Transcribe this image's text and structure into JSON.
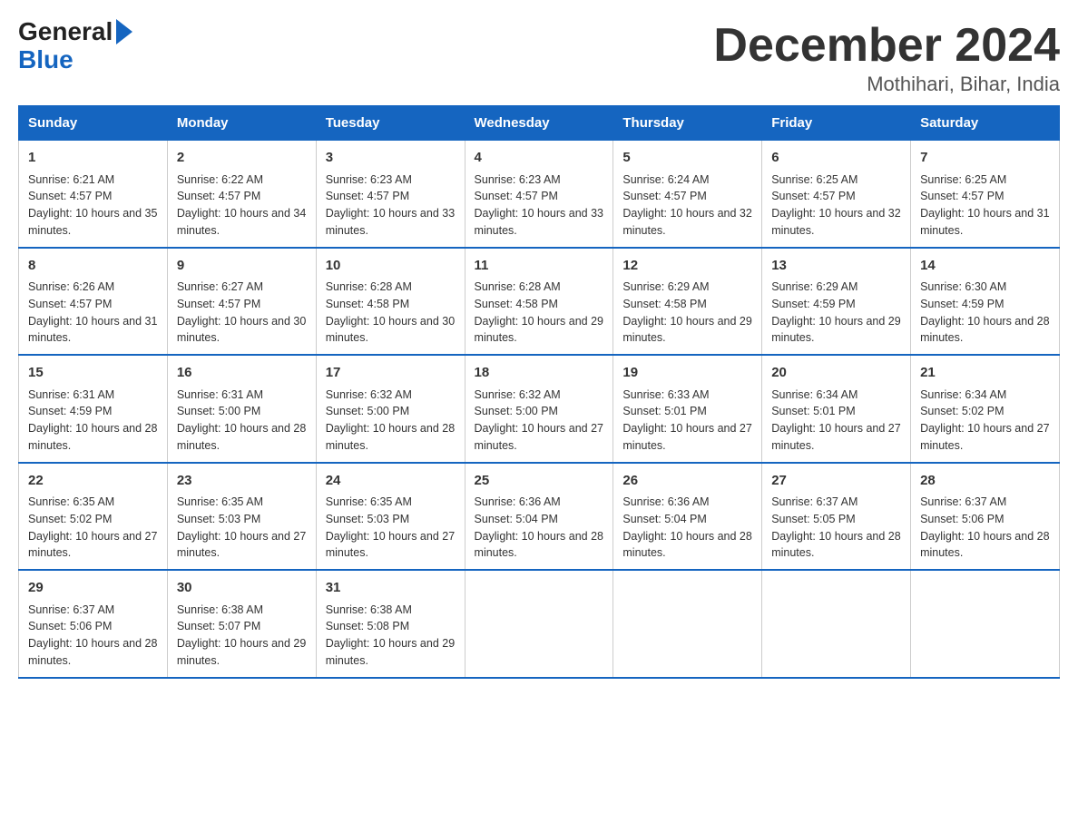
{
  "logo": {
    "line1": "General",
    "arrow": "▶",
    "line2": "Blue"
  },
  "title": "December 2024",
  "subtitle": "Mothihari, Bihar, India",
  "weekdays": [
    "Sunday",
    "Monday",
    "Tuesday",
    "Wednesday",
    "Thursday",
    "Friday",
    "Saturday"
  ],
  "weeks": [
    [
      {
        "day": "1",
        "sunrise": "6:21 AM",
        "sunset": "4:57 PM",
        "daylight": "10 hours and 35 minutes."
      },
      {
        "day": "2",
        "sunrise": "6:22 AM",
        "sunset": "4:57 PM",
        "daylight": "10 hours and 34 minutes."
      },
      {
        "day": "3",
        "sunrise": "6:23 AM",
        "sunset": "4:57 PM",
        "daylight": "10 hours and 33 minutes."
      },
      {
        "day": "4",
        "sunrise": "6:23 AM",
        "sunset": "4:57 PM",
        "daylight": "10 hours and 33 minutes."
      },
      {
        "day": "5",
        "sunrise": "6:24 AM",
        "sunset": "4:57 PM",
        "daylight": "10 hours and 32 minutes."
      },
      {
        "day": "6",
        "sunrise": "6:25 AM",
        "sunset": "4:57 PM",
        "daylight": "10 hours and 32 minutes."
      },
      {
        "day": "7",
        "sunrise": "6:25 AM",
        "sunset": "4:57 PM",
        "daylight": "10 hours and 31 minutes."
      }
    ],
    [
      {
        "day": "8",
        "sunrise": "6:26 AM",
        "sunset": "4:57 PM",
        "daylight": "10 hours and 31 minutes."
      },
      {
        "day": "9",
        "sunrise": "6:27 AM",
        "sunset": "4:57 PM",
        "daylight": "10 hours and 30 minutes."
      },
      {
        "day": "10",
        "sunrise": "6:28 AM",
        "sunset": "4:58 PM",
        "daylight": "10 hours and 30 minutes."
      },
      {
        "day": "11",
        "sunrise": "6:28 AM",
        "sunset": "4:58 PM",
        "daylight": "10 hours and 29 minutes."
      },
      {
        "day": "12",
        "sunrise": "6:29 AM",
        "sunset": "4:58 PM",
        "daylight": "10 hours and 29 minutes."
      },
      {
        "day": "13",
        "sunrise": "6:29 AM",
        "sunset": "4:59 PM",
        "daylight": "10 hours and 29 minutes."
      },
      {
        "day": "14",
        "sunrise": "6:30 AM",
        "sunset": "4:59 PM",
        "daylight": "10 hours and 28 minutes."
      }
    ],
    [
      {
        "day": "15",
        "sunrise": "6:31 AM",
        "sunset": "4:59 PM",
        "daylight": "10 hours and 28 minutes."
      },
      {
        "day": "16",
        "sunrise": "6:31 AM",
        "sunset": "5:00 PM",
        "daylight": "10 hours and 28 minutes."
      },
      {
        "day": "17",
        "sunrise": "6:32 AM",
        "sunset": "5:00 PM",
        "daylight": "10 hours and 28 minutes."
      },
      {
        "day": "18",
        "sunrise": "6:32 AM",
        "sunset": "5:00 PM",
        "daylight": "10 hours and 27 minutes."
      },
      {
        "day": "19",
        "sunrise": "6:33 AM",
        "sunset": "5:01 PM",
        "daylight": "10 hours and 27 minutes."
      },
      {
        "day": "20",
        "sunrise": "6:34 AM",
        "sunset": "5:01 PM",
        "daylight": "10 hours and 27 minutes."
      },
      {
        "day": "21",
        "sunrise": "6:34 AM",
        "sunset": "5:02 PM",
        "daylight": "10 hours and 27 minutes."
      }
    ],
    [
      {
        "day": "22",
        "sunrise": "6:35 AM",
        "sunset": "5:02 PM",
        "daylight": "10 hours and 27 minutes."
      },
      {
        "day": "23",
        "sunrise": "6:35 AM",
        "sunset": "5:03 PM",
        "daylight": "10 hours and 27 minutes."
      },
      {
        "day": "24",
        "sunrise": "6:35 AM",
        "sunset": "5:03 PM",
        "daylight": "10 hours and 27 minutes."
      },
      {
        "day": "25",
        "sunrise": "6:36 AM",
        "sunset": "5:04 PM",
        "daylight": "10 hours and 28 minutes."
      },
      {
        "day": "26",
        "sunrise": "6:36 AM",
        "sunset": "5:04 PM",
        "daylight": "10 hours and 28 minutes."
      },
      {
        "day": "27",
        "sunrise": "6:37 AM",
        "sunset": "5:05 PM",
        "daylight": "10 hours and 28 minutes."
      },
      {
        "day": "28",
        "sunrise": "6:37 AM",
        "sunset": "5:06 PM",
        "daylight": "10 hours and 28 minutes."
      }
    ],
    [
      {
        "day": "29",
        "sunrise": "6:37 AM",
        "sunset": "5:06 PM",
        "daylight": "10 hours and 28 minutes."
      },
      {
        "day": "30",
        "sunrise": "6:38 AM",
        "sunset": "5:07 PM",
        "daylight": "10 hours and 29 minutes."
      },
      {
        "day": "31",
        "sunrise": "6:38 AM",
        "sunset": "5:08 PM",
        "daylight": "10 hours and 29 minutes."
      },
      null,
      null,
      null,
      null
    ]
  ],
  "labels": {
    "sunrise": "Sunrise:",
    "sunset": "Sunset:",
    "daylight": "Daylight:"
  }
}
